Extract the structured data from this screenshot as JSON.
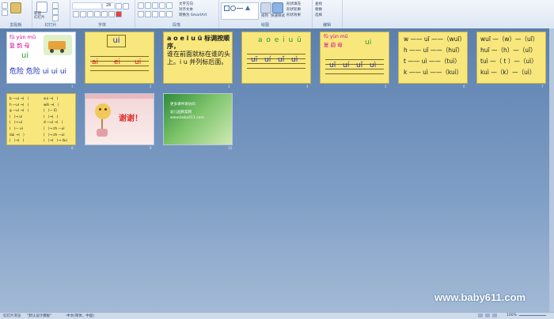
{
  "ribbon": {
    "groups": [
      {
        "label": "剪贴板"
      },
      {
        "label": "幻灯片"
      },
      {
        "label": "字体"
      },
      {
        "label": "段落"
      },
      {
        "label": "绘图"
      },
      {
        "label": "编辑"
      }
    ],
    "new_slide_label": "新建\n幻灯片",
    "font_size_value": "28",
    "shape_fill": "形状填充",
    "shape_outline": "形状轮廓",
    "shape_effect": "形状效果",
    "arrange": "排列",
    "quick_style": "快速样式",
    "find": "查找",
    "replace": "替换",
    "select": "选择",
    "text_direction": "文字方向",
    "align_text": "对齐文本",
    "smartart": "转换为 SmartArt"
  },
  "slides": [
    {
      "number": "1",
      "pinyin": "fū yùn mǔ",
      "label": "复 韵 母",
      "big": "ui",
      "line": "危险 危险 ui ui ui"
    },
    {
      "number": "2",
      "top": "ui",
      "cells": [
        "ai",
        "ei",
        "ui"
      ]
    },
    {
      "number": "3",
      "title": "a o e i u ü 标调按顺序，",
      "body": "谁在前面就标在谁的头上。i u 并列标后面。"
    },
    {
      "number": "4",
      "vowels": "a o e i u ü",
      "cells": [
        "uī",
        "uí",
        "uǐ",
        "uì"
      ]
    },
    {
      "number": "5",
      "pinyin": "fū yùn mǔ",
      "label": "复 韵 母",
      "big": "ui",
      "cells": [
        "uī",
        "uí",
        "uǐ",
        "uì"
      ]
    },
    {
      "number": "6",
      "rows": [
        "w —— uī ——（wuī）",
        "h —— uī ——（huī）",
        "t —— uì ——（tuì）",
        "k —— uì ——（kuì）"
      ]
    },
    {
      "number": "7",
      "rows": [
        "wuī —（w）—（uī）",
        "huī —（h）—（uī）",
        "tuì —（ t ）—（uì）",
        "kuì —（k）—（uì）"
      ]
    },
    {
      "number": "8",
      "left": [
        "b —uì →(　)",
        "h —uì →(　)",
        "g —uì →(　)",
        "(　)→ uì",
        "(　)→ uì",
        "(　)— uì",
        "duì →(　)",
        "(　)→(　)"
      ],
      "right": [
        "suì →(　)",
        "wěi →(　)",
        "(　)— lǚ",
        "(　)→(　)",
        "d —uì →(　)",
        "(　)→ zh —uì",
        "(　)→ zh —uì",
        "(　)→(　)→ dui"
      ]
    },
    {
      "number": "9",
      "thanks": "谢谢！"
    },
    {
      "number": "10",
      "title": "更多课件请访问：",
      "lines": [
        "幼儿园教案网",
        "www.baby611.com"
      ]
    }
  ],
  "status": {
    "slide_view": "幻灯片浏览",
    "theme": "\"默认设计模板\"",
    "language": "中文(简体，中国)",
    "zoom": "100%"
  },
  "watermark": "www.baby611.com"
}
